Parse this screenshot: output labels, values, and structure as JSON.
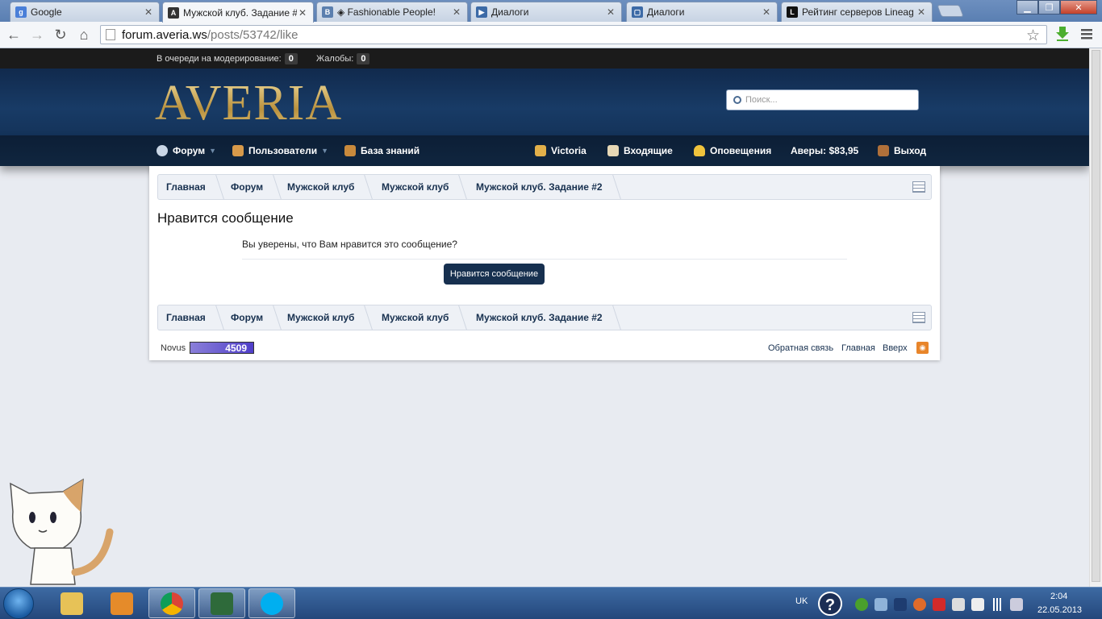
{
  "browser": {
    "tabs": [
      {
        "title": "Google",
        "favicon_color": "#4a7fd8",
        "favicon_letter": "g"
      },
      {
        "title": "Мужской клуб. Задание #",
        "favicon_color": "#333333",
        "favicon_letter": "A"
      },
      {
        "title": "◈ Fashionable People!",
        "favicon_color": "#5b7fae",
        "favicon_letter": "B"
      },
      {
        "title": "Диалоги",
        "favicon_color": "#3c6aa6",
        "favicon_letter": "▶"
      },
      {
        "title": "Диалоги",
        "favicon_color": "#3c6aa6",
        "favicon_letter": "▢"
      },
      {
        "title": "Рейтинг серверов Lineag",
        "favicon_color": "#111111",
        "favicon_letter": "L"
      }
    ],
    "url_host": "forum.averia.ws",
    "url_path": "/posts/53742/like"
  },
  "moderation": {
    "queue_label": "В очереди на модерирование:",
    "queue_count": "0",
    "reports_label": "Жалобы:",
    "reports_count": "0"
  },
  "header": {
    "logo": "AVERIA",
    "search_placeholder": "Поиск..."
  },
  "nav": {
    "forum": "Форум",
    "users": "Пользователи",
    "knowledge": "База знаний",
    "user": "Victoria",
    "inbox": "Входящие",
    "alerts": "Оповещения",
    "balance": "Аверы: $83,95",
    "logout": "Выход"
  },
  "breadcrumb": [
    "Главная",
    "Форум",
    "Мужской клуб",
    "Мужской клуб",
    "Мужской клуб. Задание #2"
  ],
  "page": {
    "title": "Нравится сообщение",
    "question": "Вы уверены, что Вам нравится это сообщение?",
    "button": "Нравится сообщение"
  },
  "footer": {
    "style": "Novus",
    "counter": "4509",
    "links": [
      "Обратная связь",
      "Главная",
      "Вверх"
    ]
  },
  "taskbar": {
    "lang": "UK",
    "time": "2:04",
    "date": "22.05.2013"
  },
  "colors": {
    "header_bg": "#14335a",
    "nav_bg": "#0c1e36",
    "link": "#17304f",
    "button_bg": "#17304f"
  }
}
